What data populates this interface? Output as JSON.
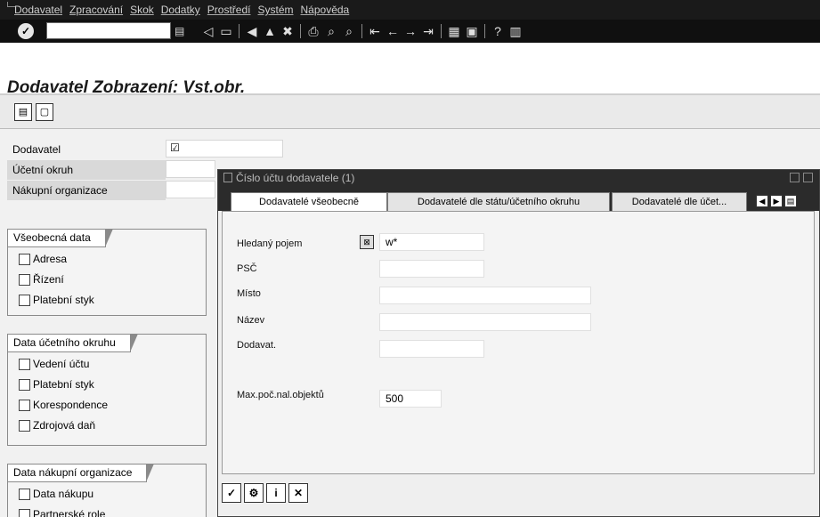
{
  "menu": [
    "Dodavatel",
    "Zpracování",
    "Skok",
    "Dodatky",
    "Prostředí",
    "Systém",
    "Nápověda"
  ],
  "toolbar": {
    "command_value": "",
    "icons": [
      "enter-icon",
      "back-icon",
      "save-icon",
      "back-nav-icon",
      "exit-icon",
      "cancel-icon",
      "print-icon",
      "find-icon",
      "find-next-icon",
      "first-page-icon",
      "prev-page-icon",
      "next-page-icon",
      "last-page-icon",
      "new-session-icon",
      "shortcut-icon",
      "help-icon",
      "layout-icon"
    ]
  },
  "title": "Dodavatel Zobrazení: Vst.obr.",
  "fields": {
    "dodavatel_label": "Dodavatel",
    "ucetni_okruh_label": "Účetní okruh",
    "nakupni_org_label": "Nákupní organizace"
  },
  "groups": {
    "vseobecna": {
      "title": "Všeobecná data",
      "items": [
        "Adresa",
        "Řízení",
        "Platební styk"
      ]
    },
    "ucetni": {
      "title": "Data účetního okruhu",
      "items": [
        "Vedení účtu",
        "Platební styk",
        "Korespondence",
        "Zdrojová daň"
      ]
    },
    "nakupni": {
      "title": "Data nákupní organizace",
      "items": [
        "Data nákupu",
        "Partnerské role"
      ]
    }
  },
  "modal": {
    "title": "Číslo účtu dodavatele (1)",
    "tabs": [
      "Dodavatelé všeobecně",
      "Dodavatelé dle státu/účetního okruhu",
      "Dodavatelé dle účet..."
    ],
    "rows": {
      "hledany_label": "Hledaný pojem",
      "hledany_value": "w*",
      "psc_label": "PSČ",
      "misto_label": "Místo",
      "nazev_label": "Název",
      "dodavat_label": "Dodavat.",
      "max_label": "Max.poč.nal.objektů",
      "max_value": "500"
    }
  }
}
